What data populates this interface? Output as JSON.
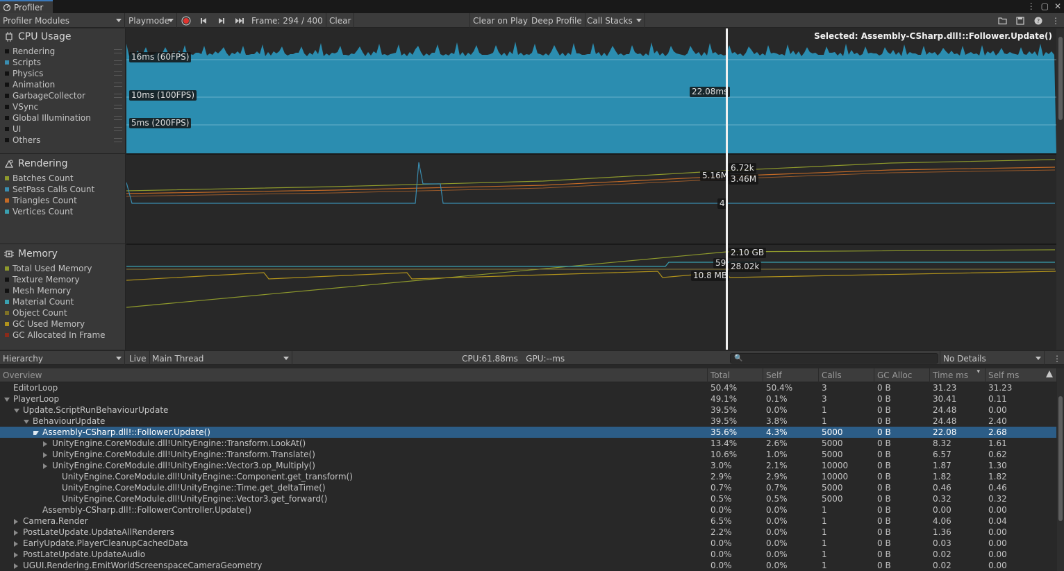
{
  "window": {
    "tab_title": "Profiler"
  },
  "toolbar": {
    "modules_dropdown": "Profiler Modules",
    "playmode_dropdown": "Playmode",
    "frame_label": "Frame: 294 / 400",
    "clear": "Clear",
    "clear_on_play": "Clear on Play",
    "deep_profile": "Deep Profile",
    "call_stacks": "Call Stacks"
  },
  "modules": {
    "cpu": {
      "title": "CPU Usage",
      "legend": [
        "Rendering",
        "Scripts",
        "Physics",
        "Animation",
        "GarbageCollector",
        "VSync",
        "Global Illumination",
        "UI",
        "Others"
      ]
    },
    "rendering": {
      "title": "Rendering",
      "legend": [
        "Batches Count",
        "SetPass Calls Count",
        "Triangles Count",
        "Vertices Count"
      ]
    },
    "memory": {
      "title": "Memory",
      "legend": [
        "Total Used Memory",
        "Texture Memory",
        "Mesh Memory",
        "Material Count",
        "Object Count",
        "GC Used Memory",
        "GC Allocated In Frame"
      ]
    }
  },
  "charts": {
    "selected_label": "Selected: Assembly-CSharp.dll!::Follower.Update()",
    "cpu_guides": [
      "16ms (60FPS)",
      "10ms (100FPS)",
      "5ms (200FPS)"
    ],
    "cpu_value": "22.08ms",
    "rendering_values": [
      "6.72k",
      "5.16M",
      "3.46M",
      "4"
    ],
    "memory_values": [
      "2.10 GB",
      "59",
      "28.02k",
      "10.8 MB"
    ]
  },
  "details": {
    "view_dropdown": "Hierarchy",
    "live": "Live",
    "thread_dropdown": "Main Thread",
    "stats": "CPU:61.88ms   GPU:--ms",
    "details_dropdown": "No Details"
  },
  "table": {
    "columns": [
      "Overview",
      "Total",
      "Self",
      "Calls",
      "GC Alloc",
      "Time ms",
      "Self ms"
    ],
    "rows": [
      {
        "name": "EditorLoop",
        "total": "50.4%",
        "self": "50.4%",
        "calls": "3",
        "gc": "0 B",
        "time": "31.23",
        "selfms": "31.23"
      },
      {
        "name": "PlayerLoop",
        "total": "49.1%",
        "self": "0.1%",
        "calls": "3",
        "gc": "0 B",
        "time": "30.41",
        "selfms": "0.11"
      },
      {
        "name": "Update.ScriptRunBehaviourUpdate",
        "total": "39.5%",
        "self": "0.0%",
        "calls": "1",
        "gc": "0 B",
        "time": "24.48",
        "selfms": "0.00"
      },
      {
        "name": "BehaviourUpdate",
        "total": "39.5%",
        "self": "3.8%",
        "calls": "1",
        "gc": "0 B",
        "time": "24.48",
        "selfms": "2.40"
      },
      {
        "name": "Assembly-CSharp.dll!::Follower.Update()",
        "total": "35.6%",
        "self": "4.3%",
        "calls": "5000",
        "gc": "0 B",
        "time": "22.08",
        "selfms": "2.68"
      },
      {
        "name": "UnityEngine.CoreModule.dll!UnityEngine::Transform.LookAt()",
        "total": "13.4%",
        "self": "2.6%",
        "calls": "5000",
        "gc": "0 B",
        "time": "8.32",
        "selfms": "1.61"
      },
      {
        "name": "UnityEngine.CoreModule.dll!UnityEngine::Transform.Translate()",
        "total": "10.6%",
        "self": "1.0%",
        "calls": "5000",
        "gc": "0 B",
        "time": "6.57",
        "selfms": "0.62"
      },
      {
        "name": "UnityEngine.CoreModule.dll!UnityEngine::Vector3.op_Multiply()",
        "total": "3.0%",
        "self": "2.1%",
        "calls": "10000",
        "gc": "0 B",
        "time": "1.87",
        "selfms": "1.30"
      },
      {
        "name": "UnityEngine.CoreModule.dll!UnityEngine::Component.get_transform()",
        "total": "2.9%",
        "self": "2.9%",
        "calls": "10000",
        "gc": "0 B",
        "time": "1.82",
        "selfms": "1.82"
      },
      {
        "name": "UnityEngine.CoreModule.dll!UnityEngine::Time.get_deltaTime()",
        "total": "0.7%",
        "self": "0.7%",
        "calls": "5000",
        "gc": "0 B",
        "time": "0.46",
        "selfms": "0.46"
      },
      {
        "name": "UnityEngine.CoreModule.dll!UnityEngine::Vector3.get_forward()",
        "total": "0.5%",
        "self": "0.5%",
        "calls": "5000",
        "gc": "0 B",
        "time": "0.32",
        "selfms": "0.32"
      },
      {
        "name": "Assembly-CSharp.dll!::FollowerController.Update()",
        "total": "0.0%",
        "self": "0.0%",
        "calls": "1",
        "gc": "0 B",
        "time": "0.00",
        "selfms": "0.00"
      },
      {
        "name": "Camera.Render",
        "total": "6.5%",
        "self": "0.0%",
        "calls": "1",
        "gc": "0 B",
        "time": "4.06",
        "selfms": "0.04"
      },
      {
        "name": "PostLateUpdate.UpdateAllRenderers",
        "total": "2.2%",
        "self": "0.0%",
        "calls": "1",
        "gc": "0 B",
        "time": "1.36",
        "selfms": "0.00"
      },
      {
        "name": "EarlyUpdate.PlayerCleanupCachedData",
        "total": "0.0%",
        "self": "0.0%",
        "calls": "1",
        "gc": "0 B",
        "time": "0.03",
        "selfms": "0.00"
      },
      {
        "name": "PostLateUpdate.UpdateAudio",
        "total": "0.0%",
        "self": "0.0%",
        "calls": "1",
        "gc": "0 B",
        "time": "0.02",
        "selfms": "0.00"
      },
      {
        "name": "UGUI.Rendering.EmitWorldScreenspaceCameraGeometry",
        "total": "0.0%",
        "self": "0.0%",
        "calls": "1",
        "gc": "0 B",
        "time": "0.02",
        "selfms": "0.00"
      }
    ]
  },
  "colors": {
    "cpu_fill": "#2b8db0",
    "selection": "#2c5d87",
    "batches": "#8f9a2c",
    "setpass": "#3a8db0",
    "triangles": "#c46a26",
    "vertices": "#3aa0b0",
    "total_used_memory": "#8f9a2c",
    "material_count": "#3aa0b0",
    "object_count": "#7f7226",
    "gc_used_memory": "#b0921c"
  }
}
